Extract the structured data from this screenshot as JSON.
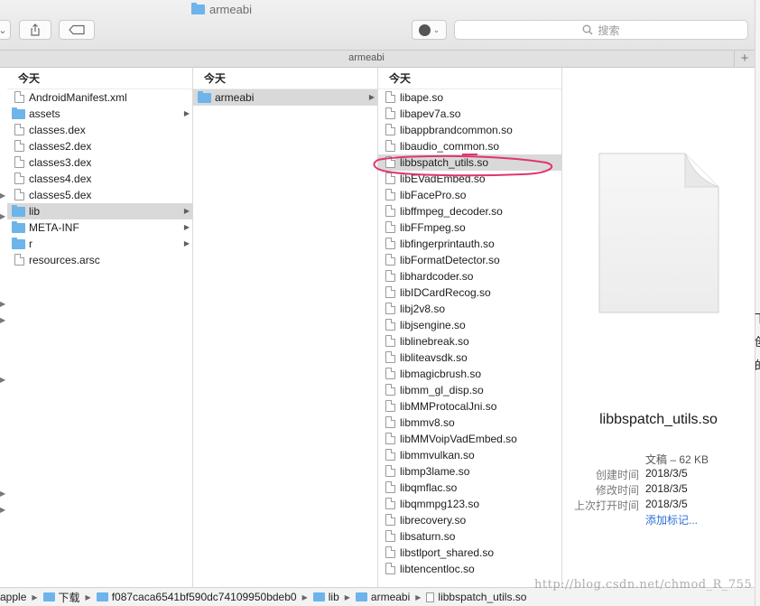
{
  "window": {
    "title": "armeabi",
    "tab_title": "armeabi",
    "search_placeholder": "搜索",
    "add_tab": "+"
  },
  "columns": [
    {
      "header": "今天",
      "items": [
        {
          "name": "AndroidManifest.xml",
          "type": "file"
        },
        {
          "name": "assets",
          "type": "folder",
          "arrow": true
        },
        {
          "name": "classes.dex",
          "type": "file"
        },
        {
          "name": "classes2.dex",
          "type": "file"
        },
        {
          "name": "classes3.dex",
          "type": "file"
        },
        {
          "name": "classes4.dex",
          "type": "file"
        },
        {
          "name": "classes5.dex",
          "type": "file"
        },
        {
          "name": "lib",
          "type": "folder",
          "arrow": true,
          "selected": true
        },
        {
          "name": "META-INF",
          "type": "folder",
          "arrow": true
        },
        {
          "name": "r",
          "type": "folder",
          "arrow": true
        },
        {
          "name": "resources.arsc",
          "type": "file"
        }
      ]
    },
    {
      "header": "今天",
      "items": [
        {
          "name": "armeabi",
          "type": "folder",
          "arrow": true,
          "selected": true
        }
      ]
    },
    {
      "header": "今天",
      "items": [
        {
          "name": "libape.so",
          "type": "file"
        },
        {
          "name": "libapev7a.so",
          "type": "file"
        },
        {
          "name": "libappbrandcommon.so",
          "type": "file"
        },
        {
          "name": "libaudio_common.so",
          "type": "file"
        },
        {
          "name": "libbspatch_utils.so",
          "type": "file",
          "selected": true
        },
        {
          "name": "libEVadEmbed.so",
          "type": "file"
        },
        {
          "name": "libFacePro.so",
          "type": "file"
        },
        {
          "name": "libffmpeg_decoder.so",
          "type": "file"
        },
        {
          "name": "libFFmpeg.so",
          "type": "file"
        },
        {
          "name": "libfingerprintauth.so",
          "type": "file"
        },
        {
          "name": "libFormatDetector.so",
          "type": "file"
        },
        {
          "name": "libhardcoder.so",
          "type": "file"
        },
        {
          "name": "libIDCardRecog.so",
          "type": "file"
        },
        {
          "name": "libj2v8.so",
          "type": "file"
        },
        {
          "name": "libjsengine.so",
          "type": "file"
        },
        {
          "name": "liblinebreak.so",
          "type": "file"
        },
        {
          "name": "libliteavsdk.so",
          "type": "file"
        },
        {
          "name": "libmagicbrush.so",
          "type": "file"
        },
        {
          "name": "libmm_gl_disp.so",
          "type": "file"
        },
        {
          "name": "libMMProtocalJni.so",
          "type": "file"
        },
        {
          "name": "libmmv8.so",
          "type": "file"
        },
        {
          "name": "libMMVoipVadEmbed.so",
          "type": "file"
        },
        {
          "name": "libmmvulkan.so",
          "type": "file"
        },
        {
          "name": "libmp3lame.so",
          "type": "file"
        },
        {
          "name": "libqmflac.so",
          "type": "file"
        },
        {
          "name": "libqmmpg123.so",
          "type": "file"
        },
        {
          "name": "librecovery.so",
          "type": "file"
        },
        {
          "name": "libsaturn.so",
          "type": "file"
        },
        {
          "name": "libstlport_shared.so",
          "type": "file"
        },
        {
          "name": "libtencentloc.so",
          "type": "file"
        }
      ]
    }
  ],
  "preview": {
    "name": "libbspatch_utils.so",
    "kind_size": "文稿 – 62 KB",
    "meta": [
      {
        "label": "创建时间",
        "value": "2018/3/5"
      },
      {
        "label": "修改时间",
        "value": "2018/3/5"
      },
      {
        "label": "上次打开时间",
        "value": "2018/3/5"
      }
    ],
    "add_tags": "添加标记..."
  },
  "path": [
    "apple",
    "下载",
    "f087caca6541bf590dc74109950bdeb0",
    "lib",
    "armeabi",
    "libbspatch_utils.so"
  ],
  "side_glyphs": [
    "下",
    "创",
    "的"
  ],
  "watermark": "http://blog.csdn.net/chmod_R_755",
  "colors": {
    "folder": "#6cb4ea",
    "selection": "#d9d9d9",
    "annotation": "#e0366b",
    "link": "#2d6fd6"
  }
}
